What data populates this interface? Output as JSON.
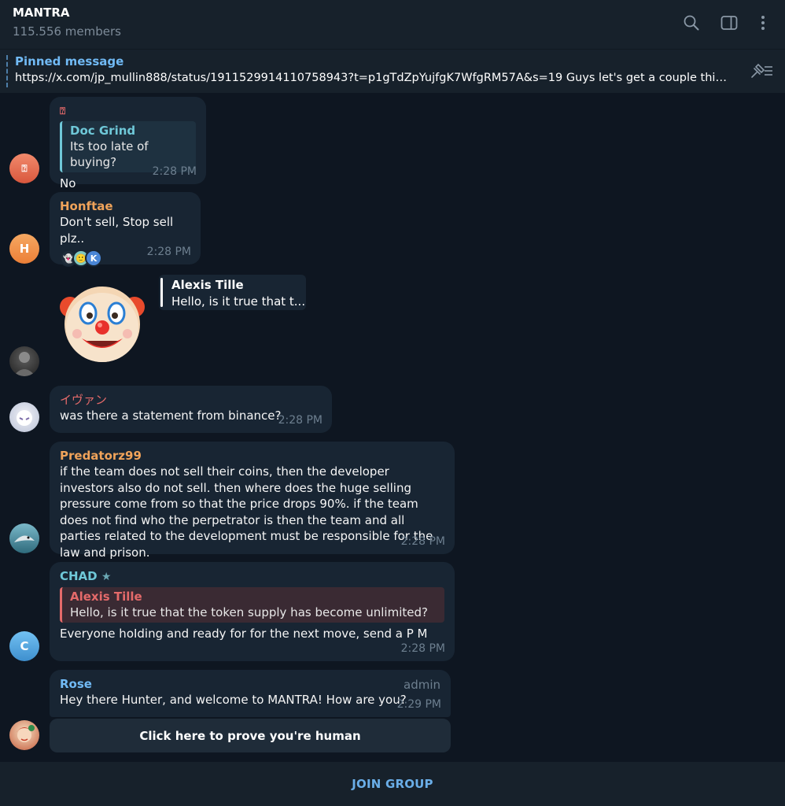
{
  "header": {
    "title": "MANTRA",
    "members": "115.556 members"
  },
  "pinned": {
    "label": "Pinned message",
    "text": "https://x.com/jp_mullin888/status/1911529914110758943?t=p1gTdZpYujfgK7WfgRM57A&s=19  Guys let's get a couple things straight. Over the last couple of days we've seen"
  },
  "messages": [
    {
      "sender": "⍰",
      "quote_name": "Doc Grind",
      "quote_text": "Its too late of buying?",
      "text": "No",
      "time": "2:28 PM",
      "avatar_glyph": "⍰"
    },
    {
      "sender": "Honftae",
      "text": "Don't sell, Stop sell plz..",
      "time": "2:28 PM",
      "avatar_letter": "H",
      "reactions": [
        "👻",
        "🙂",
        "K"
      ]
    },
    {
      "quote_name": "Alexis Tille",
      "quote_text": "Hello, is it true that t...",
      "sticker": "🤡"
    },
    {
      "sender": "イヴァン",
      "text": "was there a statement from binance?",
      "time": "2:28 PM"
    },
    {
      "sender": "Predatorz99",
      "text": "if the team does not sell their coins, then the developer investors also do not sell. then where does the huge selling pressure come from so that the price drops 90%. if the team does not find who the perpetrator is then the team and all parties related to the development must be responsible for the law and prison.",
      "time": "2:28 PM"
    },
    {
      "sender": "CHAD",
      "quote_name": "Alexis Tille",
      "quote_text": "Hello, is it true that the token supply has become unlimited?",
      "text": "Everyone hoIding and ready for for the next move, send a P M",
      "time": "2:28 PM",
      "avatar_letter": "C"
    },
    {
      "sender": "Rose",
      "role": "admin",
      "text": "Hey there Hunter, and welcome to MANTRA! How are you?",
      "time": "2:29 PM"
    }
  ],
  "inline_button": "Click here to prove you're human",
  "join_button": "JOIN GROUP",
  "colors": {
    "background": "#0e1621",
    "panel": "#17212b",
    "bubble": "#182533",
    "accent": "#6aaee8",
    "orange_name": "#f0a35a",
    "red_name": "#e56a6a",
    "cyan_name": "#6fc8d8",
    "blue_name": "#71baf5"
  }
}
